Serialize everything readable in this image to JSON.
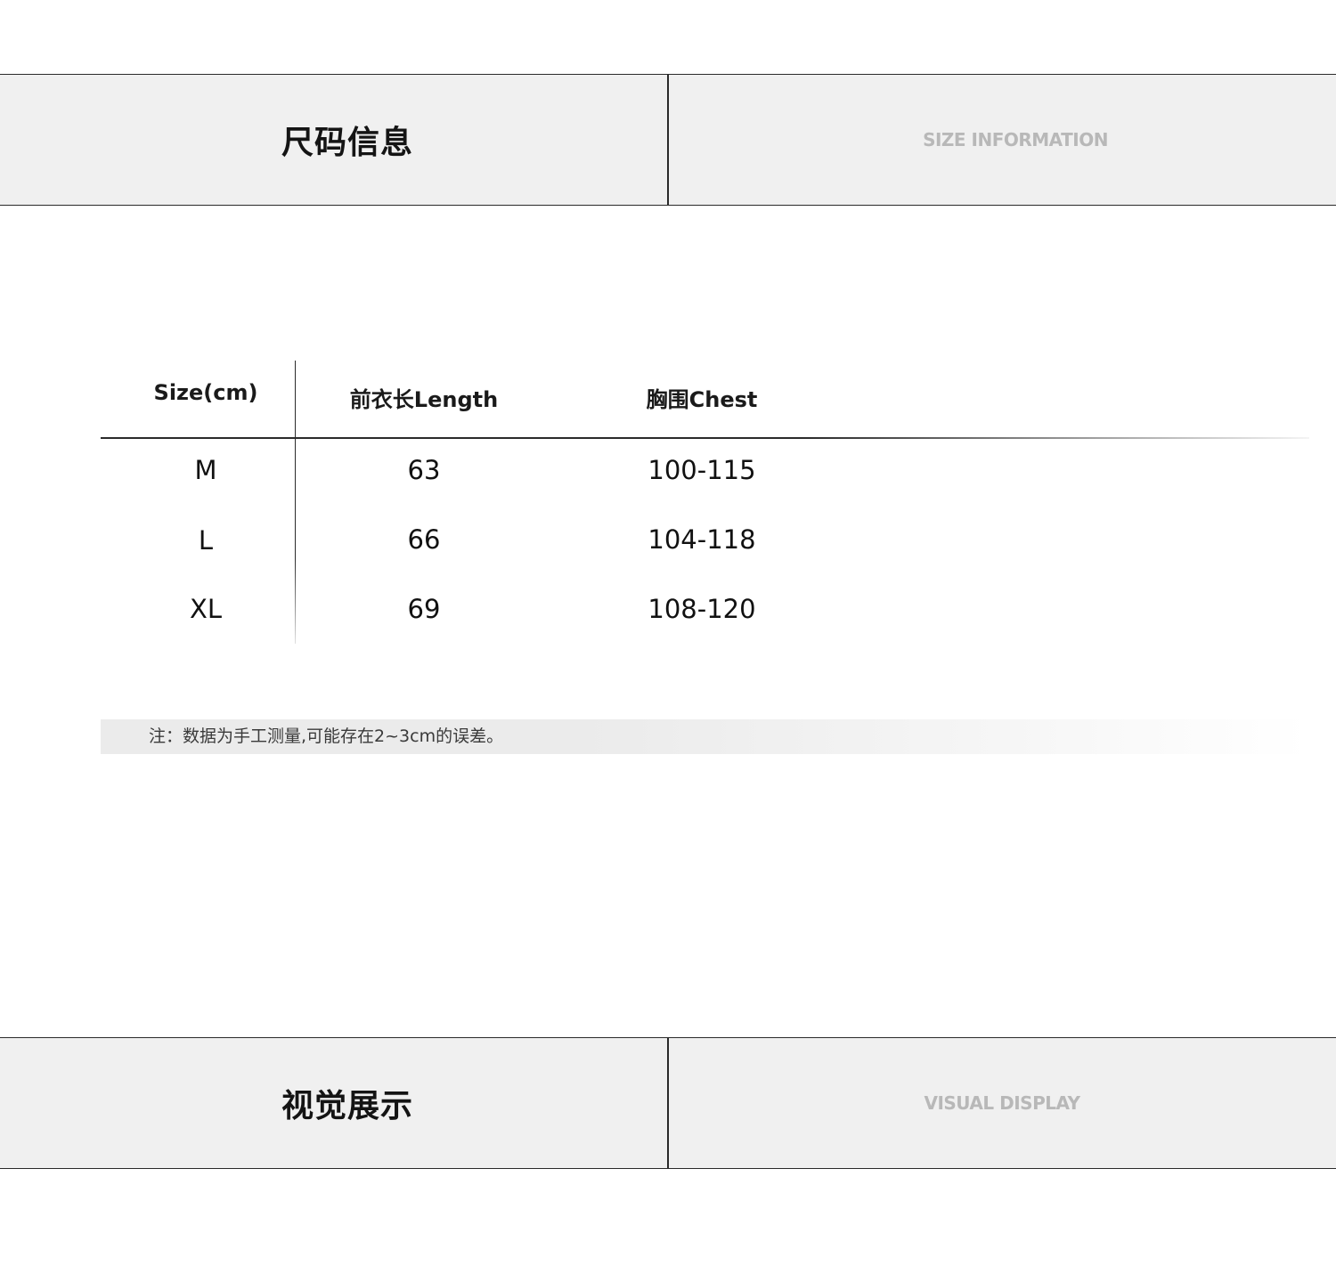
{
  "sections": {
    "size_info": {
      "title_zh": "尺码信息",
      "title_en": "SIZE INFORMATION"
    },
    "visual_display": {
      "title_zh": "视觉展示",
      "title_en": "VISUAL DISPLAY"
    }
  },
  "size_table": {
    "headers": [
      "Size(cm)",
      "前衣长Length",
      "胸围Chest"
    ],
    "rows": [
      {
        "size": "M",
        "length": "63",
        "chest": "100-115"
      },
      {
        "size": "L",
        "length": "66",
        "chest": "104-118"
      },
      {
        "size": "XL",
        "length": "69",
        "chest": "108-120"
      }
    ]
  },
  "note": "注：数据为手工测量,可能存在2~3cm的误差。"
}
